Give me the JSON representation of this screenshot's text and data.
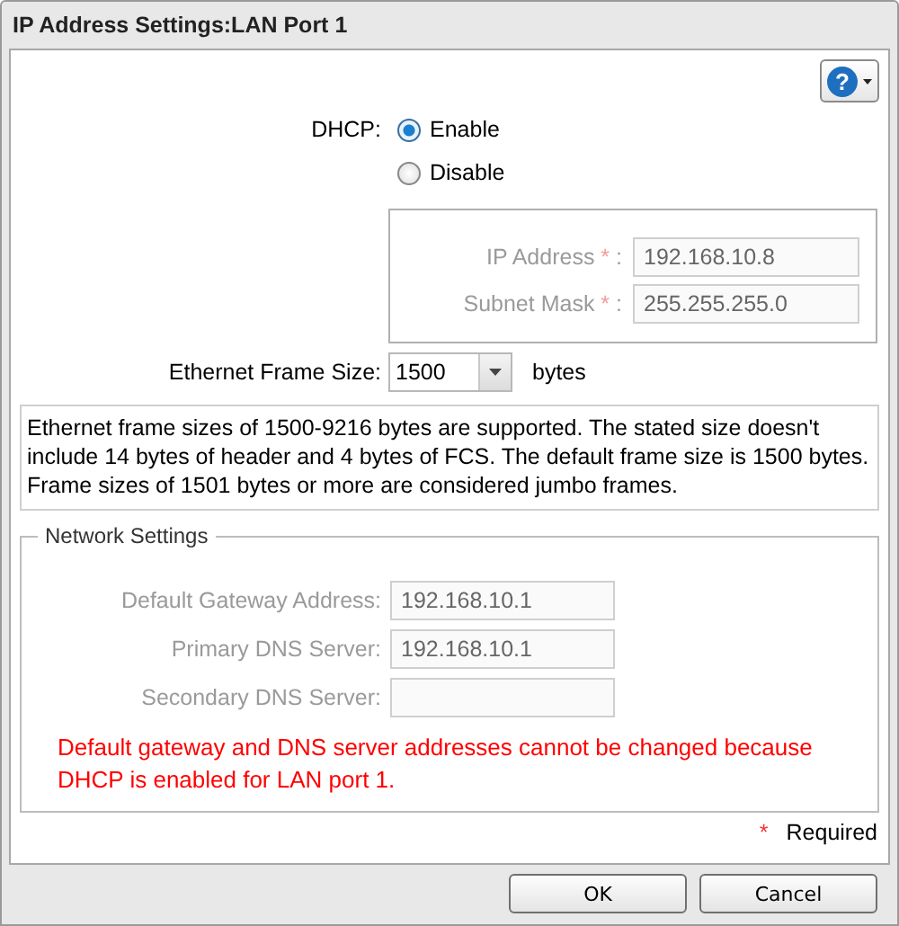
{
  "window": {
    "title": "IP Address Settings:LAN Port 1"
  },
  "help_button": {
    "symbol": "?"
  },
  "dhcp": {
    "label": "DHCP:",
    "options": [
      {
        "label": "Enable",
        "selected": true
      },
      {
        "label": "Disable",
        "selected": false
      }
    ]
  },
  "ip_settings": {
    "disabled": true,
    "fields": [
      {
        "label": "IP Address",
        "asterisk": "*",
        "colon": ":",
        "value": "192.168.10.8"
      },
      {
        "label": "Subnet Mask",
        "asterisk": "*",
        "colon": ":",
        "value": "255.255.255.0"
      }
    ]
  },
  "frame_size": {
    "label": "Ethernet Frame Size:",
    "value": "1500",
    "unit": "bytes"
  },
  "note": "Ethernet frame sizes of 1500-9216 bytes are supported. The stated size doesn't include 14 bytes of header and 4 bytes of FCS. The default frame size is 1500 bytes. Frame sizes of 1501 bytes or more are considered jumbo frames.",
  "network_settings": {
    "title": "Network Settings",
    "disabled": true,
    "fields": [
      {
        "label": "Default Gateway Address:",
        "value": "192.168.10.1"
      },
      {
        "label": "Primary DNS Server:",
        "value": "192.168.10.1"
      },
      {
        "label": "Secondary DNS Server:"
      }
    ],
    "warning": "Default gateway and DNS server addresses cannot be changed because DHCP is enabled for LAN port 1."
  },
  "required_note": {
    "asterisk": "*",
    "label": "Required"
  },
  "buttons": [
    {
      "label": "OK"
    },
    {
      "label": "Cancel"
    }
  ]
}
